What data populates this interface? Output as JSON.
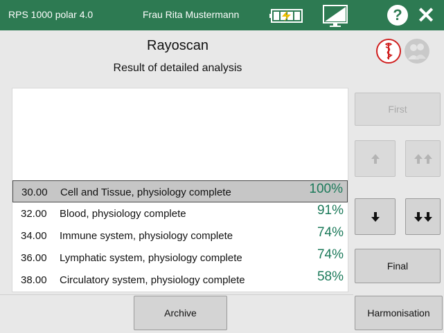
{
  "titlebar": {
    "app_name": "RPS 1000 polar 4.0",
    "user_name": "Frau Rita Mustermann",
    "icons": [
      "battery-charging-icon",
      "display-icon",
      "help-icon",
      "close-icon"
    ],
    "help_glyph": "?",
    "close_glyph": "✕",
    "background_color": "#2d7a52"
  },
  "header": {
    "title": "Rayoscan",
    "subtitle": "Result of detailed analysis",
    "icons": [
      "caduceus-icon",
      "person-couple-icon"
    ]
  },
  "results": [
    {
      "code": "30.00",
      "label": "Cell and Tissue, physiology complete",
      "percent": "100%",
      "selected": true
    },
    {
      "code": "32.00",
      "label": "Blood, physiology complete",
      "percent": "91%",
      "selected": false
    },
    {
      "code": "34.00",
      "label": "Immune system, physiology complete",
      "percent": "74%",
      "selected": false
    },
    {
      "code": "36.00",
      "label": "Lymphatic system, physiology complete",
      "percent": "74%",
      "selected": false
    },
    {
      "code": "38.00",
      "label": "Circulatory system, physiology complete",
      "percent": "58%",
      "selected": false
    }
  ],
  "nav": {
    "first_label": "First",
    "final_label": "Final",
    "archive_label": "Archive",
    "harmonisation_label": "Harmonisation",
    "icons": [
      "arrow-up-icon",
      "double-arrow-up-icon",
      "arrow-down-icon",
      "double-arrow-down-icon"
    ]
  },
  "colors": {
    "percent_text": "#1c7a5a",
    "accent_red": "#d02020"
  }
}
